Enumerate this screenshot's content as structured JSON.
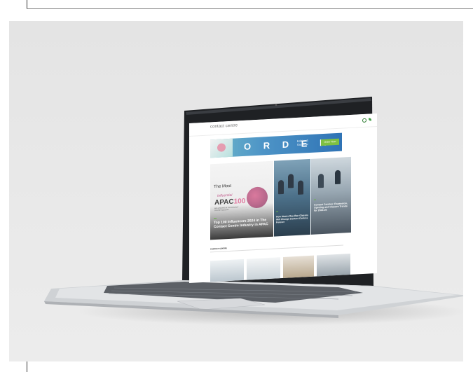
{
  "site": {
    "logo_line1": "contact centre",
    "logo_line2": "",
    "nav": [
      "",
      ""
    ]
  },
  "banner": {
    "order_text": "O R D E R",
    "edition_line1": "Edition 3",
    "edition_line2": "Out Now",
    "button_label": "Order Now"
  },
  "hero": {
    "apac_title_line1": "The Most",
    "apac_title_line2": "Influential",
    "apac_number_prefix": "APAC",
    "apac_number_suffix": "100",
    "apac_sub": "INFLUENCERS IN THE CONTACT CENTRE INDUSTRY",
    "main_headline": "Top 100 Influencers 2024 in The Contact Centre Industry in APAC",
    "mid_headline": "How Meta's Ray-Ban Glasses Will Change Contact Centres Forever",
    "right_headline": "Contact Centres: Expansion, Opening and Closure Trends for 2024-25"
  },
  "section": {
    "title": "CONTACT CENTRE"
  },
  "colors": {
    "background": "#e8e8e8",
    "banner_blue": "#2f73b5",
    "button_green": "#7fc041",
    "accent_pink": "#e07aa0"
  }
}
